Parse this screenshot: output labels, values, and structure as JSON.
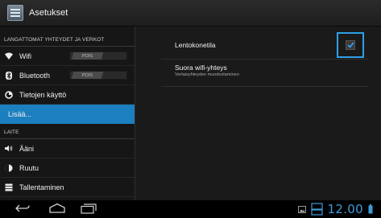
{
  "app": {
    "title": "Asetukset"
  },
  "sidebar": {
    "section_wireless": "LANGATTOMAT YHTEYDET JA VERKOT",
    "items": [
      {
        "label": "Wifi",
        "icon": "wifi-icon",
        "toggle": "POIS"
      },
      {
        "label": "Bluetooth",
        "icon": "bluetooth-icon",
        "toggle": "POIS"
      },
      {
        "label": "Tietojen käyttö",
        "icon": "data-usage-icon"
      },
      {
        "label": "Lisää...",
        "selected": true
      }
    ],
    "section_device": "LAITE",
    "device_items": [
      {
        "label": "Ääni",
        "icon": "volume-icon"
      },
      {
        "label": "Ruutu",
        "icon": "display-icon"
      },
      {
        "label": "Tallentaminen",
        "icon": "storage-icon"
      }
    ]
  },
  "main": {
    "airplane_mode": {
      "title": "Lentokonetila",
      "checked": true
    },
    "wifi_direct": {
      "title": "Suora wifi-yhteys",
      "summary": "Vertaisyhteyden muodostaminen"
    }
  },
  "statusbar": {
    "time": "12.00"
  },
  "colors": {
    "accent": "#2ea0e6",
    "selected_bg": "#1c7fc0",
    "clock": "#3e9bd8"
  }
}
